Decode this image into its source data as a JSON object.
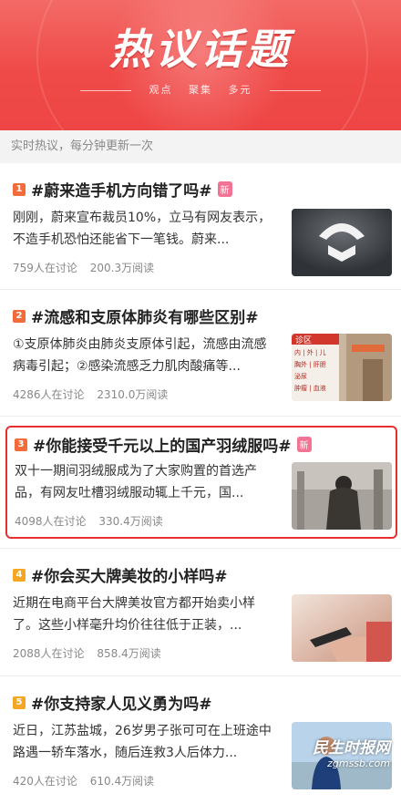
{
  "banner": {
    "title": "热议话题",
    "sub1": "观点",
    "sub2": "聚集",
    "sub3": "多元"
  },
  "subheader": "实时热议，每分钟更新一次",
  "items": [
    {
      "rank": "1",
      "rank_color": "#f26b3a",
      "topic": "#蔚来造手机方向错了吗#",
      "badge": "新",
      "desc": "刚刚，蔚来宣布裁员10%，立马有网友表示，不造手机恐怕还能省下一笔钱。蔚来...",
      "discuss": "759人在讨论",
      "reads": "200.3万阅读",
      "thumb_icon": "nio-logo-photo"
    },
    {
      "rank": "2",
      "rank_color": "#f26b3a",
      "topic": "#流感和支原体肺炎有哪些区别#",
      "badge": "",
      "desc": "①支原体肺炎由肺炎支原体引起，流感由流感病毒引起；②感染流感乏力肌肉酸痛等...",
      "discuss": "4286人在讨论",
      "reads": "2310.0万阅读",
      "thumb_icon": "hospital-sign-photo",
      "thumb_labels": [
        "诊区",
        "内 | 外 | 儿",
        "胸外 | 肝胆",
        "泌尿",
        "肿瘤 | 血液"
      ]
    },
    {
      "rank": "3",
      "rank_color": "#f26b3a",
      "topic": "#你能接受千元以上的国产羽绒服吗#",
      "badge": "新",
      "desc": "双十一期间羽绒服成为了大家购置的首选产品，有网友吐槽羽绒服动辄上千元，国...",
      "discuss": "4098人在讨论",
      "reads": "330.4万阅读",
      "thumb_icon": "down-jacket-photo"
    },
    {
      "rank": "4",
      "rank_color": "#f5a623",
      "topic": "#你会买大牌美妆的小样吗#",
      "badge": "",
      "desc": "近期在电商平台大牌美妆官方都开始卖小样了。这些小样毫升均价往往低于正装，...",
      "discuss": "2088人在讨论",
      "reads": "858.4万阅读",
      "thumb_icon": "phone-hand-photo"
    },
    {
      "rank": "5",
      "rank_color": "#f5a623",
      "topic": "#你支持家人见义勇为吗#",
      "badge": "",
      "desc": "近日，江苏盐城，26岁男子张可可在上班途中路遇一轿车落水，随后连救3人后体力...",
      "discuss": "420人在讨论",
      "reads": "610.4万阅读",
      "thumb_icon": "man-portrait-photo"
    }
  ],
  "watermark": {
    "title": "民生时报网",
    "url": "zgmssb.com"
  }
}
